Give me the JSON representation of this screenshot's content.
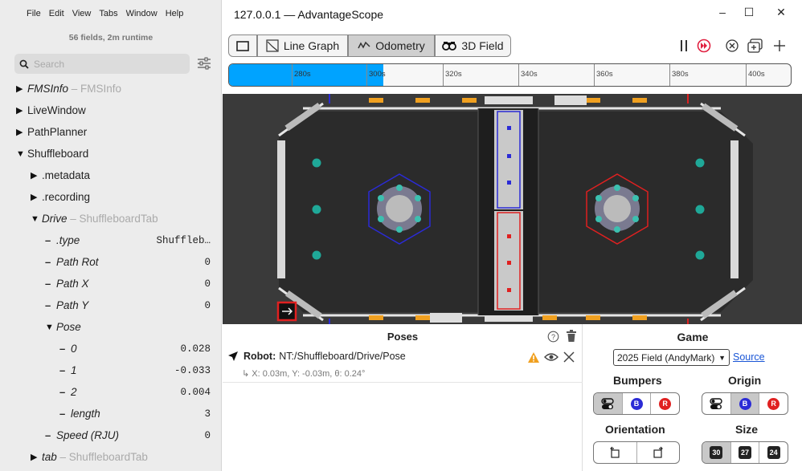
{
  "menu": [
    "File",
    "Edit",
    "View",
    "Tabs",
    "Window",
    "Help"
  ],
  "sidebar": {
    "fields_info": "56 fields, 2m runtime",
    "search_placeholder": "Search",
    "tree": [
      {
        "label": "FMSInfo",
        "type_label": "FMSInfo"
      },
      {
        "label": "LiveWindow"
      },
      {
        "label": "PathPlanner"
      },
      {
        "label": "Shuffleboard"
      },
      {
        "label": ".metadata"
      },
      {
        "label": ".recording"
      },
      {
        "label": "Drive",
        "type_label": "ShuffleboardTab"
      },
      {
        "label": ".type",
        "value": "Shuffleb…"
      },
      {
        "label": "Path Rot",
        "value": "0"
      },
      {
        "label": "Path X",
        "value": "0"
      },
      {
        "label": "Path Y",
        "value": "0"
      },
      {
        "label": "Pose"
      },
      {
        "label": "0",
        "value": "0.028"
      },
      {
        "label": "1",
        "value": "-0.033"
      },
      {
        "label": "2",
        "value": "0.004"
      },
      {
        "label": "length",
        "value": "3"
      },
      {
        "label": "Speed (RJU)",
        "value": "0"
      },
      {
        "label": "tab",
        "type_label": "ShuffleboardTab"
      }
    ]
  },
  "window": {
    "title": "127.0.0.1 — AdvantageScope"
  },
  "tabs": {
    "line_graph": "Line Graph",
    "odometry": "Odometry",
    "field3d": "3D Field"
  },
  "timeline": {
    "ticks": [
      "280s",
      "300s",
      "320s",
      "340s",
      "360s",
      "380s",
      "400s"
    ],
    "progress": 0.275
  },
  "poses": {
    "title": "Poses",
    "robot_label": "Robot:",
    "robot_source": "NT:/Shuffleboard/Drive/Pose",
    "robot_detail": "X: 0.03m, Y: -0.03m, θ: 0.24°"
  },
  "game": {
    "title": "Game",
    "selected": "2025 Field (AndyMark)",
    "source_label": "Source",
    "bumpers_title": "Bumpers",
    "origin_title": "Origin",
    "orientation_title": "Orientation",
    "size_title": "Size",
    "blue_letter": "B",
    "red_letter": "R",
    "sizes": [
      "30",
      "27",
      "24"
    ]
  },
  "colors": {
    "accent": "#00a3ff",
    "blue": "#2b2bd6",
    "red": "#e02020",
    "field_bg": "#3a3a3a"
  }
}
